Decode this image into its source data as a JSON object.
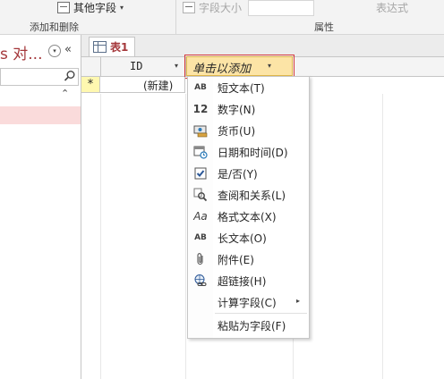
{
  "ribbon": {
    "more_fields_label": "其他字段",
    "field_size_label": "字段大小",
    "expression_label": "表达式",
    "group_add_delete": "添加和删除",
    "group_properties": "属性"
  },
  "nav": {
    "title": "s 对...",
    "dropdown_glyph": "▾",
    "collapse_glyph": "«",
    "group_chevron": "⌃"
  },
  "table": {
    "tab_label": "表1",
    "id_column": "ID",
    "add_column": "单击以添加",
    "new_record_marker": "*",
    "new_record_text": "(新建)"
  },
  "menu": {
    "items": [
      {
        "icon": "ab-short-text-icon",
        "glyph": "AB",
        "label": "短文本(T)"
      },
      {
        "icon": "number-icon",
        "glyph": "12",
        "label": "数字(N)"
      },
      {
        "icon": "currency-icon",
        "glyph": "",
        "label": "货币(U)"
      },
      {
        "icon": "calendar-clock-icon",
        "glyph": "",
        "label": "日期和时间(D)"
      },
      {
        "icon": "checkbox-icon",
        "glyph": "✔",
        "label": "是/否(Y)"
      },
      {
        "icon": "lookup-icon",
        "glyph": "",
        "label": "查阅和关系(L)"
      },
      {
        "icon": "rich-text-icon",
        "glyph": "Aa",
        "label": "格式文本(X)"
      },
      {
        "icon": "ab-long-text-icon",
        "glyph": "AB",
        "label": "长文本(O)"
      },
      {
        "icon": "paperclip-icon",
        "glyph": "",
        "label": "附件(E)"
      },
      {
        "icon": "hyperlink-icon",
        "glyph": "",
        "label": "超链接(H)"
      },
      {
        "icon": "",
        "glyph": "",
        "label": "计算字段(C)",
        "submenu": "▸"
      },
      {
        "icon": "",
        "glyph": "",
        "label": "粘贴为字段(F)"
      }
    ]
  }
}
